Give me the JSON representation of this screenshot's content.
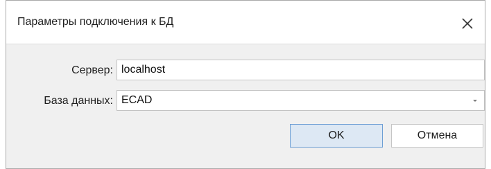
{
  "dialog": {
    "title": "Параметры подключения к БД",
    "close_icon": "close-icon"
  },
  "form": {
    "server_label": "Сервер:",
    "server_value": "localhost",
    "database_label": "База данных:",
    "database_value": "ECAD",
    "dropdown_icon": "chevron-down-icon"
  },
  "buttons": {
    "ok_label": "OK",
    "cancel_label": "Отмена"
  },
  "colors": {
    "ok_button_bg": "#dde8f4",
    "ok_button_border": "#6c9ed4"
  }
}
